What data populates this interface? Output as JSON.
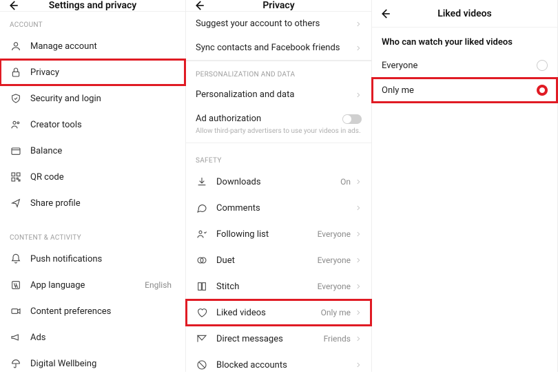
{
  "panel1": {
    "title": "Settings and privacy",
    "sections": {
      "account": {
        "label": "ACCOUNT",
        "items": [
          {
            "label": "Manage account",
            "icon": "user-icon"
          },
          {
            "label": "Privacy",
            "icon": "lock-icon",
            "highlighted": true
          },
          {
            "label": "Security and login",
            "icon": "shield-icon"
          },
          {
            "label": "Creator tools",
            "icon": "creator-icon"
          },
          {
            "label": "Balance",
            "icon": "wallet-icon"
          },
          {
            "label": "QR code",
            "icon": "qr-icon"
          },
          {
            "label": "Share profile",
            "icon": "share-icon"
          }
        ]
      },
      "content": {
        "label": "CONTENT & ACTIVITY",
        "items": [
          {
            "label": "Push notifications",
            "icon": "bell-icon"
          },
          {
            "label": "App language",
            "icon": "language-icon",
            "value": "English"
          },
          {
            "label": "Content preferences",
            "icon": "video-icon"
          },
          {
            "label": "Ads",
            "icon": "megaphone-icon"
          },
          {
            "label": "Digital Wellbeing",
            "icon": "umbrella-icon"
          }
        ]
      }
    }
  },
  "panel2": {
    "title": "Privacy",
    "top_items": [
      {
        "label": "Suggest your account to others"
      },
      {
        "label": "Sync contacts and Facebook friends"
      }
    ],
    "sections": {
      "personalization": {
        "label": "PERSONALIZATION AND DATA",
        "items": [
          {
            "label": "Personalization and data",
            "type": "link"
          },
          {
            "label": "Ad authorization",
            "type": "toggle",
            "subtext": "Allow third-party advertisers to use your videos in ads."
          }
        ]
      },
      "safety": {
        "label": "SAFETY",
        "items": [
          {
            "label": "Downloads",
            "icon": "download-icon",
            "value": "On"
          },
          {
            "label": "Comments",
            "icon": "comment-icon",
            "value": ""
          },
          {
            "label": "Following list",
            "icon": "following-icon",
            "value": "Everyone"
          },
          {
            "label": "Duet",
            "icon": "duet-icon",
            "value": "Everyone"
          },
          {
            "label": "Stitch",
            "icon": "stitch-icon",
            "value": "Everyone"
          },
          {
            "label": "Liked videos",
            "icon": "heart-icon",
            "value": "Only me",
            "highlighted": true
          },
          {
            "label": "Direct messages",
            "icon": "message-icon",
            "value": "Friends"
          },
          {
            "label": "Blocked accounts",
            "icon": "blocked-icon",
            "value": ""
          }
        ]
      }
    }
  },
  "panel3": {
    "title": "Liked videos",
    "heading": "Who can watch your liked videos",
    "options": [
      {
        "label": "Everyone",
        "checked": false
      },
      {
        "label": "Only me",
        "checked": true,
        "highlighted": true
      }
    ]
  }
}
